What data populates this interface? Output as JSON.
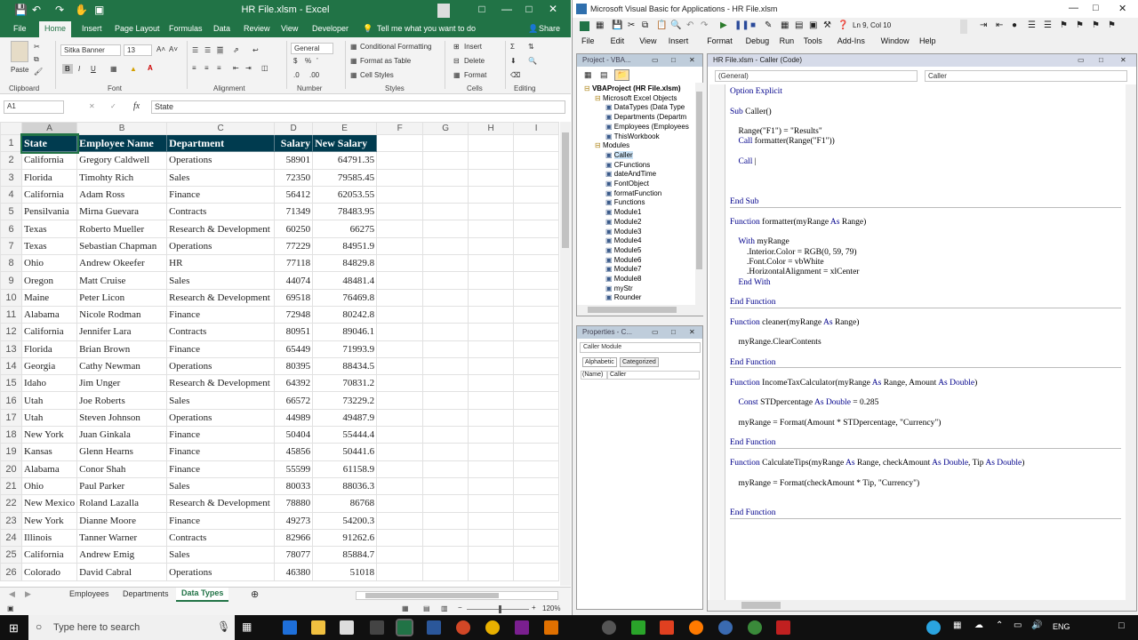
{
  "excel": {
    "title": "HR File.xlsm  -  Excel",
    "tabs": [
      "File",
      "Home",
      "Insert",
      "Page Layout",
      "Formulas",
      "Data",
      "Review",
      "View",
      "Developer"
    ],
    "tell_me": "Tell me what you want to do",
    "share": "Share",
    "ribbon": {
      "paste": "Paste",
      "clipboard": "Clipboard",
      "font_name": "Sitka Banner",
      "font_size": "13",
      "font": "Font",
      "alignment": "Alignment",
      "number_format": "General",
      "number": "Number",
      "cond_format": "Conditional Formatting",
      "format_table": "Format as Table",
      "cell_styles": "Cell Styles",
      "styles": "Styles",
      "insert": "Insert",
      "delete": "Delete",
      "format": "Format",
      "cells": "Cells",
      "editing": "Editing"
    },
    "name_box": "A1",
    "formula": "State",
    "columns": [
      "A",
      "B",
      "C",
      "D",
      "E",
      "F",
      "G",
      "H",
      "I"
    ],
    "header": [
      "State",
      "Employee Name",
      "Department",
      "Salary",
      "New Salary"
    ],
    "rows": [
      [
        "California",
        "Gregory Caldwell",
        "Operations",
        "58901",
        "64791.35"
      ],
      [
        "Florida",
        "Timohty Rich",
        "Sales",
        "72350",
        "79585.45"
      ],
      [
        "California",
        "Adam Ross",
        "Finance",
        "56412",
        "62053.55"
      ],
      [
        "Pensilvania",
        "Mirna Guevara",
        "Contracts",
        "71349",
        "78483.95"
      ],
      [
        "Texas",
        "Roberto Mueller",
        "Research & Development",
        "60250",
        "66275"
      ],
      [
        "Texas",
        "Sebastian Chapman",
        "Operations",
        "77229",
        "84951.9"
      ],
      [
        "Ohio",
        "Andrew Okeefer",
        "HR",
        "77118",
        "84829.8"
      ],
      [
        "Oregon",
        "Matt Cruise",
        "Sales",
        "44074",
        "48481.4"
      ],
      [
        "Maine",
        "Peter Licon",
        "Research & Development",
        "69518",
        "76469.8"
      ],
      [
        "Alabama",
        "Nicole Rodman",
        "Finance",
        "72948",
        "80242.8"
      ],
      [
        "California",
        "Jennifer Lara",
        "Contracts",
        "80951",
        "89046.1"
      ],
      [
        "Florida",
        "Brian Brown",
        "Finance",
        "65449",
        "71993.9"
      ],
      [
        "Georgia",
        "Cathy Newman",
        "Operations",
        "80395",
        "88434.5"
      ],
      [
        "Idaho",
        "Jim Unger",
        "Research & Development",
        "64392",
        "70831.2"
      ],
      [
        "Utah",
        "Joe Roberts",
        "Sales",
        "66572",
        "73229.2"
      ],
      [
        "Utah",
        "Steven Johnson",
        "Operations",
        "44989",
        "49487.9"
      ],
      [
        "New York",
        "Juan Ginkala",
        "Finance",
        "50404",
        "55444.4"
      ],
      [
        "Kansas",
        "Glenn Hearns",
        "Finance",
        "45856",
        "50441.6"
      ],
      [
        "Alabama",
        "Conor Shah",
        "Finance",
        "55599",
        "61158.9"
      ],
      [
        "Ohio",
        "Paul Parker",
        "Sales",
        "80033",
        "88036.3"
      ],
      [
        "New Mexico",
        "Roland Lazalla",
        "Research & Development",
        "78880",
        "86768"
      ],
      [
        "New York",
        "Dianne Moore",
        "Finance",
        "49273",
        "54200.3"
      ],
      [
        "Illinois",
        "Tanner Warner",
        "Contracts",
        "82966",
        "91262.6"
      ],
      [
        "California",
        "Andrew Emig",
        "Sales",
        "78077",
        "85884.7"
      ],
      [
        "Colorado",
        "David Cabral",
        "Operations",
        "46380",
        "51018"
      ]
    ],
    "sheets": [
      "Employees",
      "Departments",
      "Data Types"
    ],
    "zoom": "120%"
  },
  "vba": {
    "title": "Microsoft Visual Basic for Applications - HR File.xlsm",
    "menus": [
      "File",
      "Edit",
      "View",
      "Insert",
      "Format",
      "Debug",
      "Run",
      "Tools",
      "Add-Ins",
      "Window",
      "Help"
    ],
    "position": "Ln 9, Col 10",
    "project_title": "Project - VBA...",
    "tree": [
      {
        "t": "VBAProject (HR File.xlsm)",
        "l": 0,
        "b": true
      },
      {
        "t": "Microsoft Excel Objects",
        "l": 1
      },
      {
        "t": "DataTypes (Data Type",
        "l": 2
      },
      {
        "t": "Departments (Departm",
        "l": 2
      },
      {
        "t": "Employees (Employees",
        "l": 2
      },
      {
        "t": "ThisWorkbook",
        "l": 2
      },
      {
        "t": "Modules",
        "l": 1
      },
      {
        "t": "Caller",
        "l": 2,
        "sel": true
      },
      {
        "t": "CFunctions",
        "l": 2
      },
      {
        "t": "dateAndTime",
        "l": 2
      },
      {
        "t": "FontObject",
        "l": 2
      },
      {
        "t": "formatFunction",
        "l": 2
      },
      {
        "t": "Functions",
        "l": 2
      },
      {
        "t": "Module1",
        "l": 2
      },
      {
        "t": "Module2",
        "l": 2
      },
      {
        "t": "Module3",
        "l": 2
      },
      {
        "t": "Module4",
        "l": 2
      },
      {
        "t": "Module5",
        "l": 2
      },
      {
        "t": "Module6",
        "l": 2
      },
      {
        "t": "Module7",
        "l": 2
      },
      {
        "t": "Module8",
        "l": 2
      },
      {
        "t": "myStr",
        "l": 2
      },
      {
        "t": "Rounder",
        "l": 2
      }
    ],
    "props_title": "Properties - C...",
    "props_obj": "Caller Module",
    "props_tabs": [
      "Alphabetic",
      "Categorized"
    ],
    "props_name": "(Name)",
    "props_val": "Caller",
    "code_title": "HR File.xlsm - Caller (Code)",
    "dd_left": "(General)",
    "dd_right": "Caller",
    "code": "Option Explicit\n\nSub Caller()\n\n    Range(\"F1\") = \"Results\"\n    Call formatter(Range(\"F1\"))\n\n    Call |\n\n\n\nEnd Sub\n\nFunction formatter(myRange As Range)\n\n    With myRange\n        .Interior.Color = RGB(0, 59, 79)\n        .Font.Color = vbWhite\n        .HorizontalAlignment = xlCenter\n    End With\n\nEnd Function\n\nFunction cleaner(myRange As Range)\n\n    myRange.ClearContents\n\nEnd Function\n\nFunction IncomeTaxCalculator(myRange As Range, Amount As Double)\n\n    Const STDpercentage As Double = 0.285\n\n    myRange = Format(Amount * STDpercentage, \"Currency\")\n\nEnd Function\n\nFunction CalculateTips(myRange As Range, checkAmount As Double, Tip As Double)\n\n    myRange = Format(checkAmount * Tip, \"Currency\")\n\n\nEnd Function"
  },
  "taskbar": {
    "search": "Type here to search",
    "lang": "ENG"
  }
}
